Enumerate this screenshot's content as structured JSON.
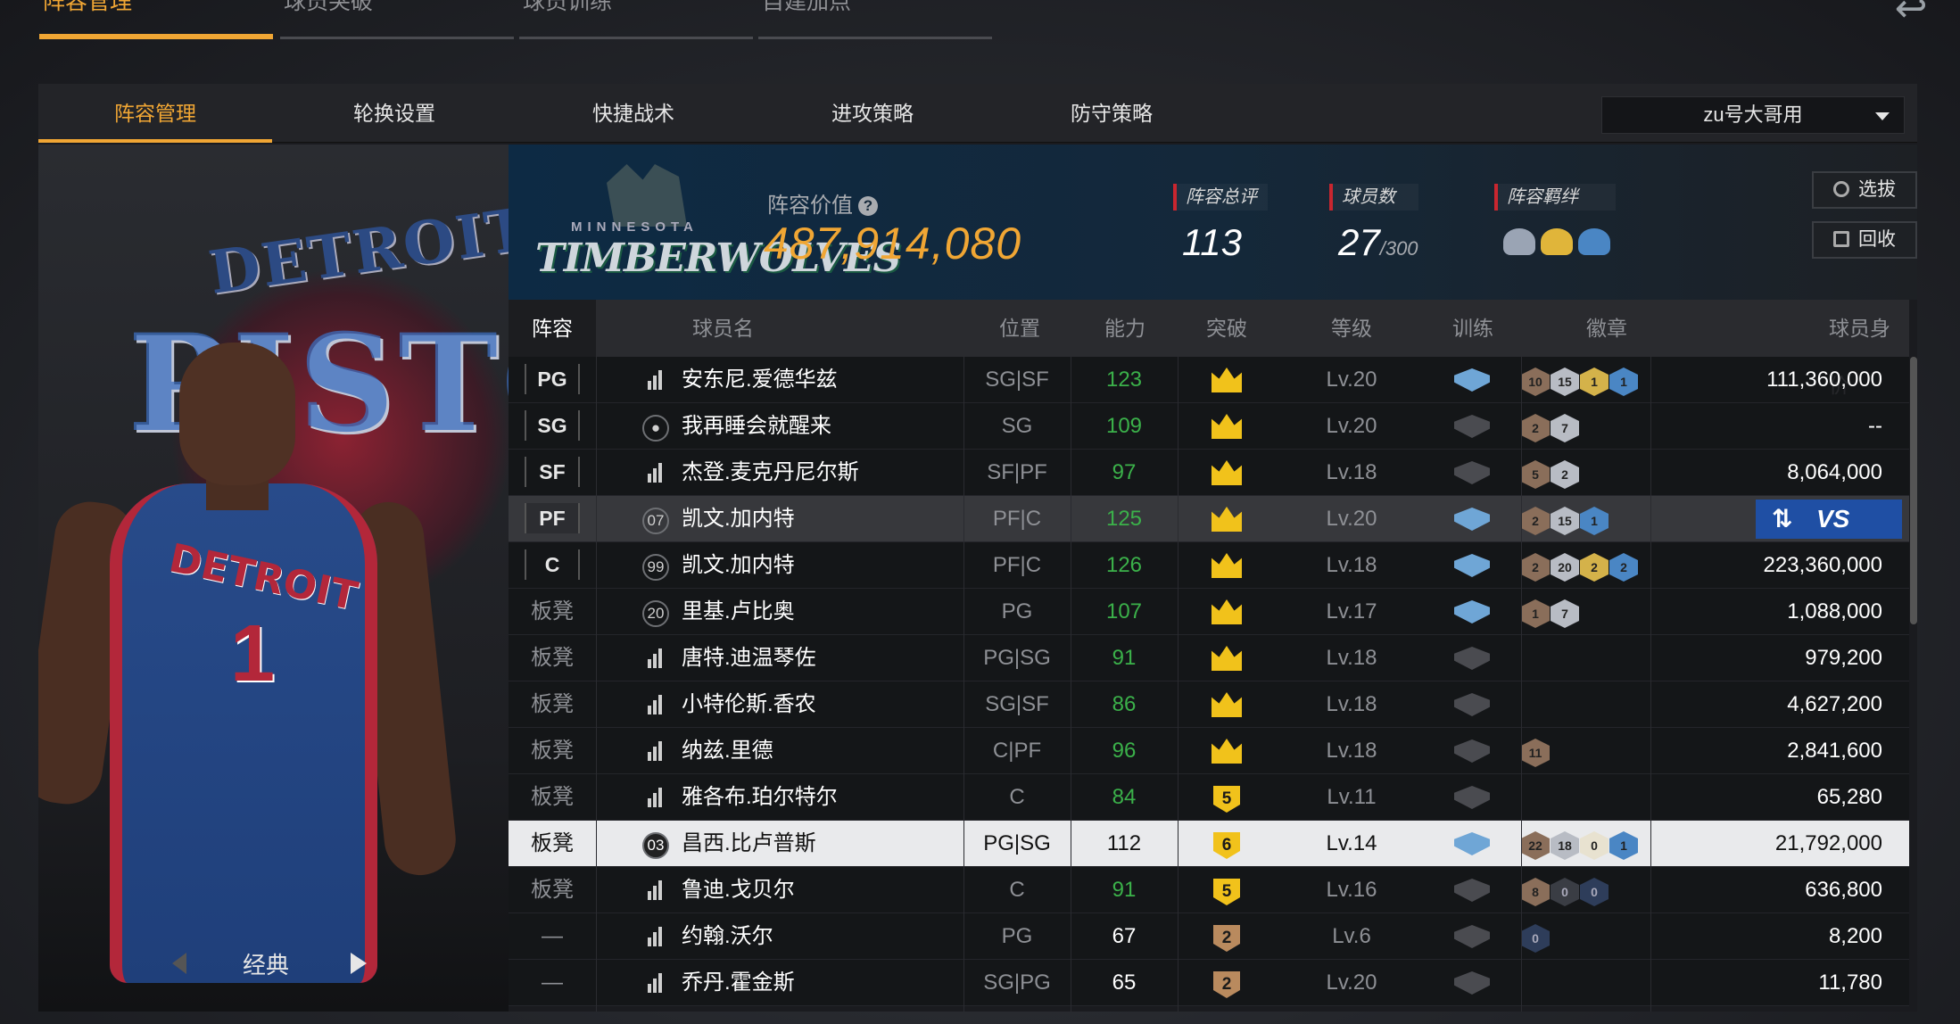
{
  "top_nav": {
    "tabs": [
      "阵容管理",
      "球员突破",
      "球员训练",
      "自建加点"
    ],
    "back_symbol": "↩"
  },
  "sub_nav": {
    "tabs": [
      "阵容管理",
      "轮换设置",
      "快捷战术",
      "进攻策略",
      "防守策略"
    ],
    "lineup_selector": "zu号大哥用"
  },
  "player_card": {
    "team_text_top": "DETROIT",
    "team_text_mid": "PISTON",
    "jersey_text": "DETROIT",
    "jersey_number": "1",
    "mode_label": "经典"
  },
  "team_header": {
    "logo_small": "MINNESOTA",
    "logo_main": "TIMBERWOLVES",
    "value_label": "阵容价值",
    "help_symbol": "?",
    "value": "487,914,080",
    "rating_label": "阵容总评",
    "rating": "113",
    "players_label": "球员数",
    "players": "27",
    "players_max": "/300",
    "bond_label": "阵容羁绊",
    "select_button": "选拔",
    "recycle_button": "回收"
  },
  "table": {
    "headers": [
      "阵容",
      "球员名",
      "位置",
      "能力",
      "突破",
      "等级",
      "训练",
      "徽章",
      "球员身价"
    ],
    "rows": [
      {
        "slot": "PG",
        "icon": "bars",
        "icon_text": "",
        "name": "安东尼.爱德华兹",
        "position": "SG|SF",
        "ability": "123",
        "break": "crown",
        "level": "Lv.20",
        "train": "blue",
        "badges": [
          "10",
          "15",
          "1",
          "1"
        ],
        "badge_colors": [
          "#8a6e5a",
          "#b8bcc4",
          "#d4b24a",
          "#4a86c4"
        ],
        "price": "111,360,000"
      },
      {
        "slot": "SG",
        "icon": "person",
        "icon_text": "",
        "name": "我再睡会就醒来",
        "position": "SG",
        "ability": "109",
        "break": "crown",
        "level": "Lv.20",
        "train": "grey",
        "badges": [
          "2",
          "7"
        ],
        "badge_colors": [
          "#8a6e5a",
          "#b8bcc4"
        ],
        "price": "--"
      },
      {
        "slot": "SF",
        "icon": "bars",
        "icon_text": "",
        "name": "杰登.麦克丹尼尔斯",
        "position": "SF|PF",
        "ability": "97",
        "break": "crown",
        "level": "Lv.18",
        "train": "grey",
        "badges": [
          "5",
          "2"
        ],
        "badge_colors": [
          "#8a6e5a",
          "#b8bcc4"
        ],
        "price": "8,064,000"
      },
      {
        "slot": "PF",
        "icon": "rank",
        "icon_text": "07",
        "name": "凯文.加内特",
        "position": "PF|C",
        "ability": "125",
        "break": "crown",
        "level": "Lv.20",
        "train": "blue",
        "badges": [
          "2",
          "15",
          "1"
        ],
        "badge_colors": [
          "#8a6e5a",
          "#b8bcc4",
          "#4a86c4"
        ],
        "price": "",
        "vs": "VS",
        "swap_symbol": "⇅",
        "highlight": true
      },
      {
        "slot": "C",
        "icon": "rank",
        "icon_text": "99",
        "name": "凯文.加内特",
        "position": "PF|C",
        "ability": "126",
        "break": "crown",
        "level": "Lv.18",
        "train": "blue",
        "badges": [
          "2",
          "20",
          "2",
          "2"
        ],
        "badge_colors": [
          "#8a6e5a",
          "#b8bcc4",
          "#d4b24a",
          "#4a86c4"
        ],
        "price": "223,360,000"
      },
      {
        "slot": "板凳",
        "icon": "rank",
        "icon_text": "20",
        "name": "里基.卢比奥",
        "position": "PG",
        "ability": "107",
        "break": "crown",
        "level": "Lv.17",
        "train": "blue",
        "badges": [
          "1",
          "7"
        ],
        "badge_colors": [
          "#8a6e5a",
          "#b8bcc4"
        ],
        "price": "1,088,000"
      },
      {
        "slot": "板凳",
        "icon": "bars",
        "icon_text": "",
        "name": "唐特.迪温琴佐",
        "position": "PG|SG",
        "ability": "91",
        "break": "crown",
        "level": "Lv.18",
        "train": "grey",
        "badges": [],
        "badge_colors": [],
        "price": "979,200"
      },
      {
        "slot": "板凳",
        "icon": "bars",
        "icon_text": "",
        "name": "小特伦斯.香农",
        "position": "SG|SF",
        "ability": "86",
        "break": "crown",
        "level": "Lv.18",
        "train": "grey",
        "badges": [],
        "badge_colors": [],
        "price": "4,627,200"
      },
      {
        "slot": "板凳",
        "icon": "bars",
        "icon_text": "",
        "name": "纳兹.里德",
        "position": "C|PF",
        "ability": "96",
        "break": "crown",
        "level": "Lv.18",
        "train": "grey",
        "badges": [
          "11"
        ],
        "badge_colors": [
          "#8a6e5a"
        ],
        "price": "2,841,600"
      },
      {
        "slot": "板凳",
        "icon": "bars",
        "icon_text": "",
        "name": "雅各布.珀尔特尔",
        "position": "C",
        "ability": "84",
        "break": "5",
        "level": "Lv.11",
        "train": "grey",
        "badges": [],
        "badge_colors": [],
        "price": "65,280"
      },
      {
        "slot": "板凳",
        "icon": "rank",
        "icon_text": "03",
        "name": "昌西.比卢普斯",
        "position": "PG|SG",
        "ability": "112",
        "break": "6",
        "level": "Lv.14",
        "train": "blue",
        "badges": [
          "22",
          "18",
          "0",
          "1"
        ],
        "badge_colors": [
          "#8a6e5a",
          "#b8bcc4",
          "#e8e2d0",
          "#4a86c4"
        ],
        "price": "21,792,000",
        "selected": true
      },
      {
        "slot": "板凳",
        "icon": "bars",
        "icon_text": "",
        "name": "鲁迪.戈贝尔",
        "position": "C",
        "ability": "91",
        "break": "5",
        "level": "Lv.16",
        "train": "grey",
        "badges": [
          "8",
          "0",
          "0"
        ],
        "badge_colors": [
          "#8a6e5a",
          "#3a3d44",
          "#2e3d5a"
        ],
        "price": "636,800"
      },
      {
        "slot": "—",
        "icon": "bars",
        "icon_text": "",
        "name": "约翰.沃尔",
        "position": "PG",
        "ability": "67",
        "break": "2",
        "level": "Lv.6",
        "train": "grey",
        "badges": [
          "0"
        ],
        "badge_colors": [
          "#2e3d5a"
        ],
        "price": "8,200",
        "ability_white": true
      },
      {
        "slot": "—",
        "icon": "bars",
        "icon_text": "",
        "name": "乔丹.霍金斯",
        "position": "SG|PG",
        "ability": "65",
        "break": "2",
        "level": "Lv.20",
        "train": "grey",
        "badges": [],
        "badge_colors": [],
        "price": "11,780",
        "ability_white": true
      }
    ]
  },
  "colors": {
    "accent": "#f0a634",
    "green_ability": "#3bb14a",
    "crown": "#f1c21b",
    "vs_blue": "#1f4fa4"
  }
}
